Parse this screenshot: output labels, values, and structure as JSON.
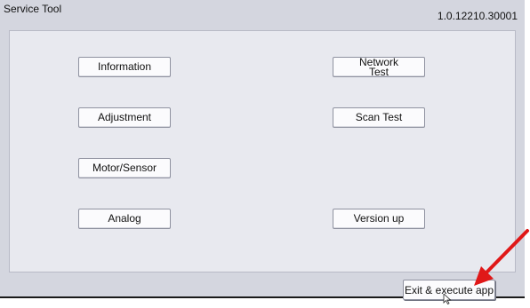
{
  "app": {
    "title": "Service Tool",
    "version": "1.0.12210.30001"
  },
  "buttons": {
    "information": "Information",
    "adjustment": "Adjustment",
    "motor_sensor": "Motor/Sensor",
    "analog": "Analog",
    "network_test": "Network\nTest",
    "scan_test": "Scan Test",
    "version_up": "Version up"
  },
  "footer": {
    "exit_label": "Exit & execute app"
  },
  "colors": {
    "background": "#d4d6df",
    "panel": "#e8e9ef",
    "annotation_arrow": "#e01818"
  },
  "icons": [
    "red-arrow-icon",
    "mouse-cursor-icon"
  ]
}
